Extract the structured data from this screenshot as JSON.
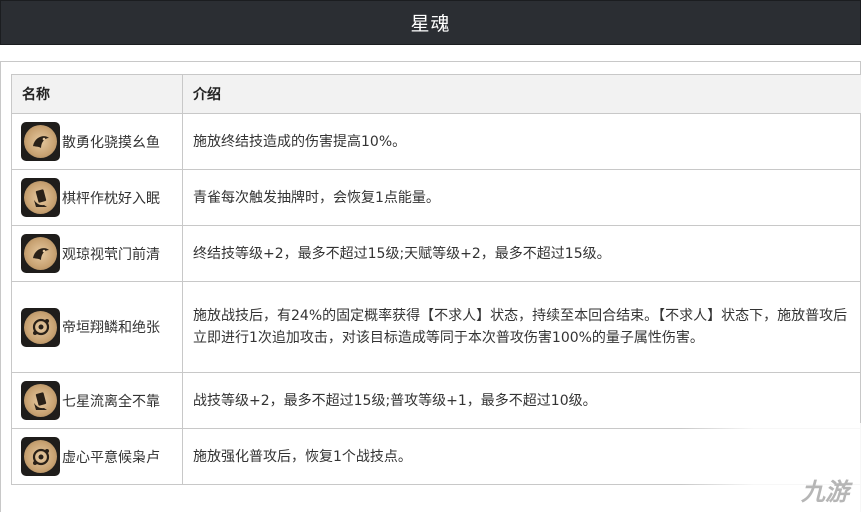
{
  "page": {
    "title": "星魂"
  },
  "table": {
    "headers": [
      "名称",
      "介绍"
    ],
    "rows": [
      {
        "name": "散勇化骁摸幺鱼",
        "icon": "fish-emblem-icon",
        "desc": "施放终结技造成的伤害提高10%。"
      },
      {
        "name": "棋枰作枕好入眠",
        "icon": "card-hand-emblem-icon",
        "desc": "青雀每次触发抽牌时，会恢复1点能量。"
      },
      {
        "name": "观琼视茕门前清",
        "icon": "fish-emblem-icon",
        "desc": "终结技等级+2，最多不超过15级;天赋等级+2，最多不超过15级。"
      },
      {
        "name": "帝垣翔鳞和绝张",
        "icon": "cloud-emblem-icon",
        "desc": "施放战技后，有24%的固定概率获得【不求人】状态，持续至本回合结束。【不求人】状态下，施放普攻后立即进行1次追加攻击，对该目标造成等同于本次普攻伤害100%的量子属性伤害。"
      },
      {
        "name": "七星流离全不靠",
        "icon": "card-hand-emblem-icon",
        "desc": "战技等级+2，最多不超过15级;普攻等级+1，最多不超过10级。"
      },
      {
        "name": "虚心平意候枭卢",
        "icon": "cloud-emblem-icon",
        "desc": "施放强化普攻后，恢复1个战技点。"
      }
    ]
  },
  "watermark": {
    "text": "九游"
  }
}
